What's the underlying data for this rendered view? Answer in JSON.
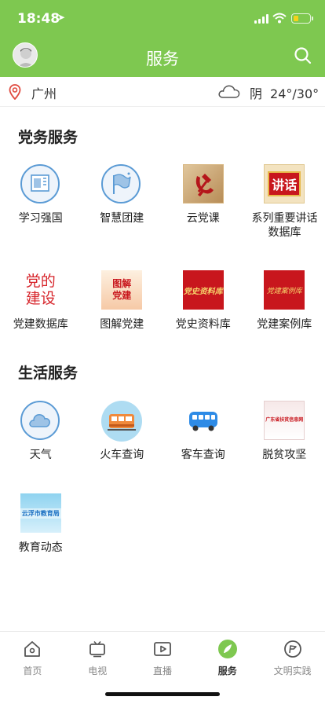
{
  "status_bar": {
    "time": "18:48"
  },
  "header": {
    "title": "服务"
  },
  "location": {
    "city": "广州",
    "condition": "阴",
    "temperature": "24°/30°"
  },
  "sections": [
    {
      "title": "党务服务",
      "items": [
        {
          "label": "学习强国",
          "icon": "study-icon"
        },
        {
          "label": "智慧团建",
          "icon": "league-flag-icon"
        },
        {
          "label": "云党课",
          "icon": "party-emblem-icon"
        },
        {
          "label": "系列重要讲话数据库",
          "icon": "speech-icon",
          "thumb_text": "讲话"
        },
        {
          "label": "党建数据库",
          "icon": "party-database-icon",
          "thumb_text": "党的建设"
        },
        {
          "label": "图解党建",
          "icon": "illustrated-party-icon",
          "thumb_text": "图解党建"
        },
        {
          "label": "党史资料库",
          "icon": "party-history-icon",
          "thumb_text": "党史资料库"
        },
        {
          "label": "党建案例库",
          "icon": "party-cases-icon",
          "thumb_text": "党建案例库"
        }
      ]
    },
    {
      "title": "生活服务",
      "items": [
        {
          "label": "天气",
          "icon": "weather-icon"
        },
        {
          "label": "火车查询",
          "icon": "train-icon"
        },
        {
          "label": "客车查询",
          "icon": "bus-icon"
        },
        {
          "label": "脱贫攻坚",
          "icon": "poverty-alleviation-icon",
          "thumb_text": "广东省扶贫信息网"
        },
        {
          "label": "教育动态",
          "icon": "education-icon",
          "thumb_text": "云浮市教育局"
        }
      ]
    }
  ],
  "tabbar": [
    {
      "label": "首页",
      "icon": "home-icon",
      "active": false
    },
    {
      "label": "电视",
      "icon": "tv-icon",
      "active": false
    },
    {
      "label": "直播",
      "icon": "live-icon",
      "active": false
    },
    {
      "label": "服务",
      "icon": "service-icon",
      "active": true
    },
    {
      "label": "文明实践",
      "icon": "civilization-icon",
      "active": false
    }
  ],
  "colors": {
    "brand": "#7ec850",
    "icon_blue": "#5b9bd5",
    "party_red": "#c8161d"
  }
}
